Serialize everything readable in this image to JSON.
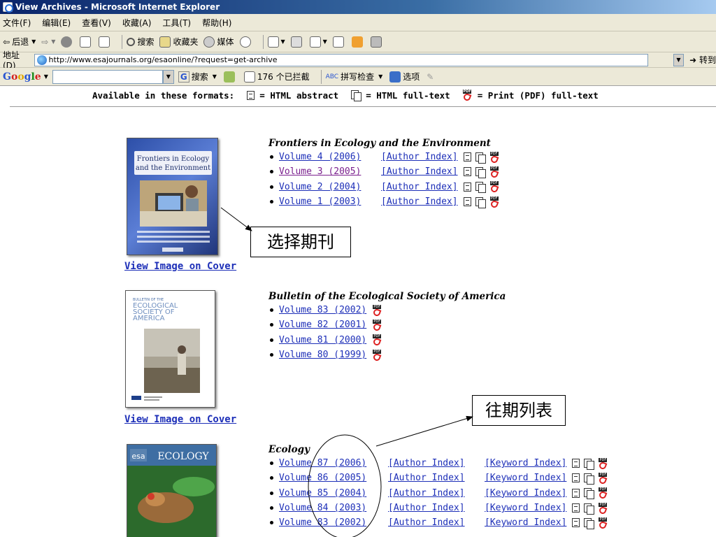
{
  "window": {
    "title": "View Archives - Microsoft Internet Explorer"
  },
  "menu": [
    "文件(F)",
    "编辑(E)",
    "查看(V)",
    "收藏(A)",
    "工具(T)",
    "帮助(H)"
  ],
  "toolbar": {
    "back": "后退",
    "search": "搜索",
    "favorites": "收藏夹",
    "media": "媒体"
  },
  "address": {
    "label": "地址(D)",
    "url": "http://www.esajournals.org/esaonline/?request=get-archive",
    "go": "转到"
  },
  "google": {
    "search_label": "搜索",
    "blocked": "176 个已拦截",
    "spell": "拼写检查",
    "options": "选项"
  },
  "formats_line": "Available in these formats:  = HTML abstract  = HTML full-text  = Print (PDF) full-text",
  "formats": {
    "prefix": "Available in these formats:",
    "abstract": "= HTML abstract",
    "fulltext": "= HTML full-text",
    "pdf": "= Print (PDF) full-text"
  },
  "journals": [
    {
      "title": "Frontiers in Ecology and the Environment",
      "view_cover": "View Image on Cover",
      "volumes": [
        {
          "label": "Volume 4 (2006)",
          "author_index": "[Author Index]",
          "visited": false
        },
        {
          "label": "Volume 3 (2005)",
          "author_index": "[Author Index]",
          "visited": true
        },
        {
          "label": "Volume 2 (2004)",
          "author_index": "[Author Index]",
          "visited": false
        },
        {
          "label": "Volume 1 (2003)",
          "author_index": "[Author Index]",
          "visited": false
        }
      ],
      "cover": {
        "line1": "Frontiers in Ecology",
        "line2": "and the Environment"
      }
    },
    {
      "title": "Bulletin of the Ecological Society of America",
      "view_cover": "View Image on Cover",
      "volumes": [
        {
          "label": "Volume 83 (2002)"
        },
        {
          "label": "Volume 82 (2001)"
        },
        {
          "label": "Volume 81 (2000)"
        },
        {
          "label": "Volume 80 (1999)"
        }
      ],
      "cover": {
        "header": "BULLETIN OF THE",
        "name1": "ECOLOGICAL",
        "name2": "SOCIETY OF",
        "name3": "AMERICA"
      }
    },
    {
      "title": "Ecology",
      "volumes": [
        {
          "label": "Volume 87 (2006)",
          "author_index": "[Author Index]",
          "keyword_index": "[Keyword Index]"
        },
        {
          "label": "Volume 86 (2005)",
          "author_index": "[Author Index]",
          "keyword_index": "[Keyword Index]"
        },
        {
          "label": "Volume 85 (2004)",
          "author_index": "[Author Index]",
          "keyword_index": "[Keyword Index]"
        },
        {
          "label": "Volume 84 (2003)",
          "author_index": "[Author Index]",
          "keyword_index": "[Keyword Index]"
        },
        {
          "label": "Volume 83 (2002)",
          "author_index": "[Author Index]",
          "keyword_index": "[Keyword Index]"
        }
      ],
      "cover": {
        "brand": "esa",
        "name": "ECOLOGY"
      }
    }
  ],
  "callouts": {
    "select_journal": "选择期刊",
    "back_issues": "往期列表"
  },
  "colors": {
    "link": "#1d2fb8",
    "visited": "#7a1f8e",
    "chrome": "#ece9d8",
    "titlebar": "#0a246a"
  }
}
